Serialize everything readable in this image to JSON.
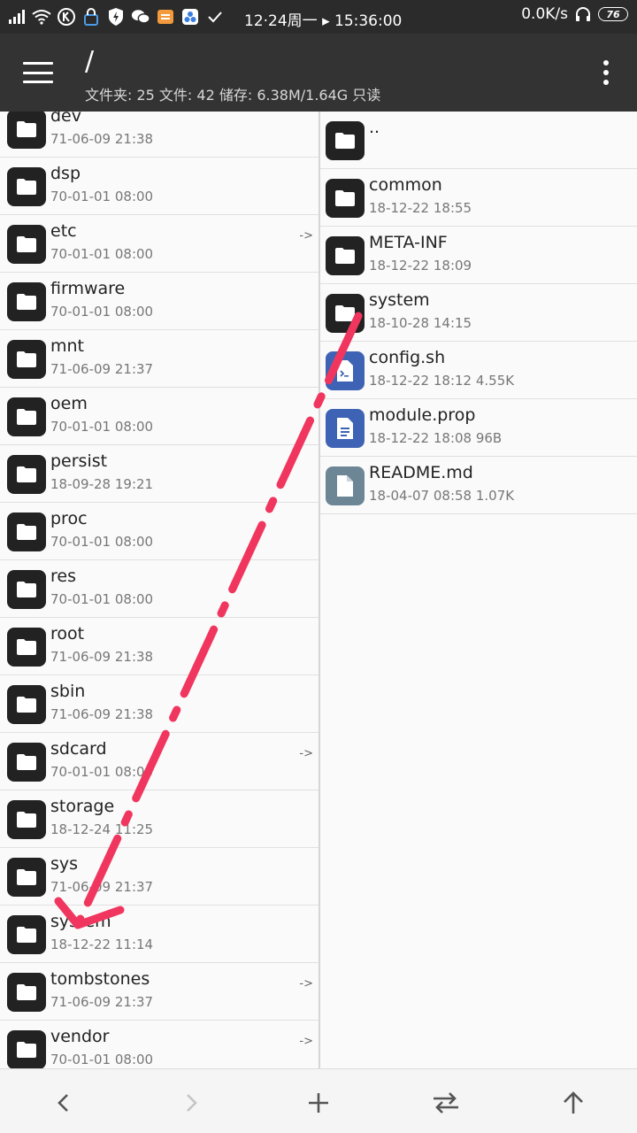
{
  "status_bar": {
    "time": "12·24周一 ▸ 15:36:00",
    "net_speed": "0.0K/s",
    "battery": "76"
  },
  "app_bar": {
    "path": "/",
    "summary": "文件夹: 25  文件: 42  储存: 6.38M/1.64G  只读"
  },
  "left_pane": {
    "items": [
      {
        "name": "dev",
        "meta": "71-06-09 21:38",
        "link": ""
      },
      {
        "name": "dsp",
        "meta": "70-01-01 08:00",
        "link": ""
      },
      {
        "name": "etc",
        "meta": "70-01-01 08:00",
        "link": "->"
      },
      {
        "name": "firmware",
        "meta": "70-01-01 08:00",
        "link": ""
      },
      {
        "name": "mnt",
        "meta": "71-06-09 21:37",
        "link": ""
      },
      {
        "name": "oem",
        "meta": "70-01-01 08:00",
        "link": ""
      },
      {
        "name": "persist",
        "meta": "18-09-28 19:21",
        "link": ""
      },
      {
        "name": "proc",
        "meta": "70-01-01 08:00",
        "link": ""
      },
      {
        "name": "res",
        "meta": "70-01-01 08:00",
        "link": ""
      },
      {
        "name": "root",
        "meta": "71-06-09 21:38",
        "link": ""
      },
      {
        "name": "sbin",
        "meta": "71-06-09 21:38",
        "link": ""
      },
      {
        "name": "sdcard",
        "meta": "70-01-01 08:00",
        "link": "->"
      },
      {
        "name": "storage",
        "meta": "18-12-24 11:25",
        "link": ""
      },
      {
        "name": "sys",
        "meta": "71-06-09 21:37",
        "link": ""
      },
      {
        "name": "system",
        "meta": "18-12-22 11:14",
        "link": ""
      },
      {
        "name": "tombstones",
        "meta": "71-06-09 21:37",
        "link": "->"
      },
      {
        "name": "vendor",
        "meta": "70-01-01 08:00",
        "link": "->"
      }
    ]
  },
  "right_pane": {
    "items": [
      {
        "name": "..",
        "meta": "",
        "kind": "folder"
      },
      {
        "name": "common",
        "meta": "18-12-22 18:55",
        "kind": "folder"
      },
      {
        "name": "META-INF",
        "meta": "18-12-22 18:09",
        "kind": "folder"
      },
      {
        "name": "system",
        "meta": "18-10-28 14:15",
        "kind": "folder"
      },
      {
        "name": "config.sh",
        "meta": "18-12-22 18:12  4.55K",
        "kind": "script"
      },
      {
        "name": "module.prop",
        "meta": "18-12-22 18:08  96B",
        "kind": "doc"
      },
      {
        "name": "README.md",
        "meta": "18-04-07 08:58  1.07K",
        "kind": "file"
      }
    ]
  },
  "colors": {
    "annotation_arrow": "#f0365e",
    "app_bar": "#333333",
    "status_bar": "#2b2b2b"
  }
}
